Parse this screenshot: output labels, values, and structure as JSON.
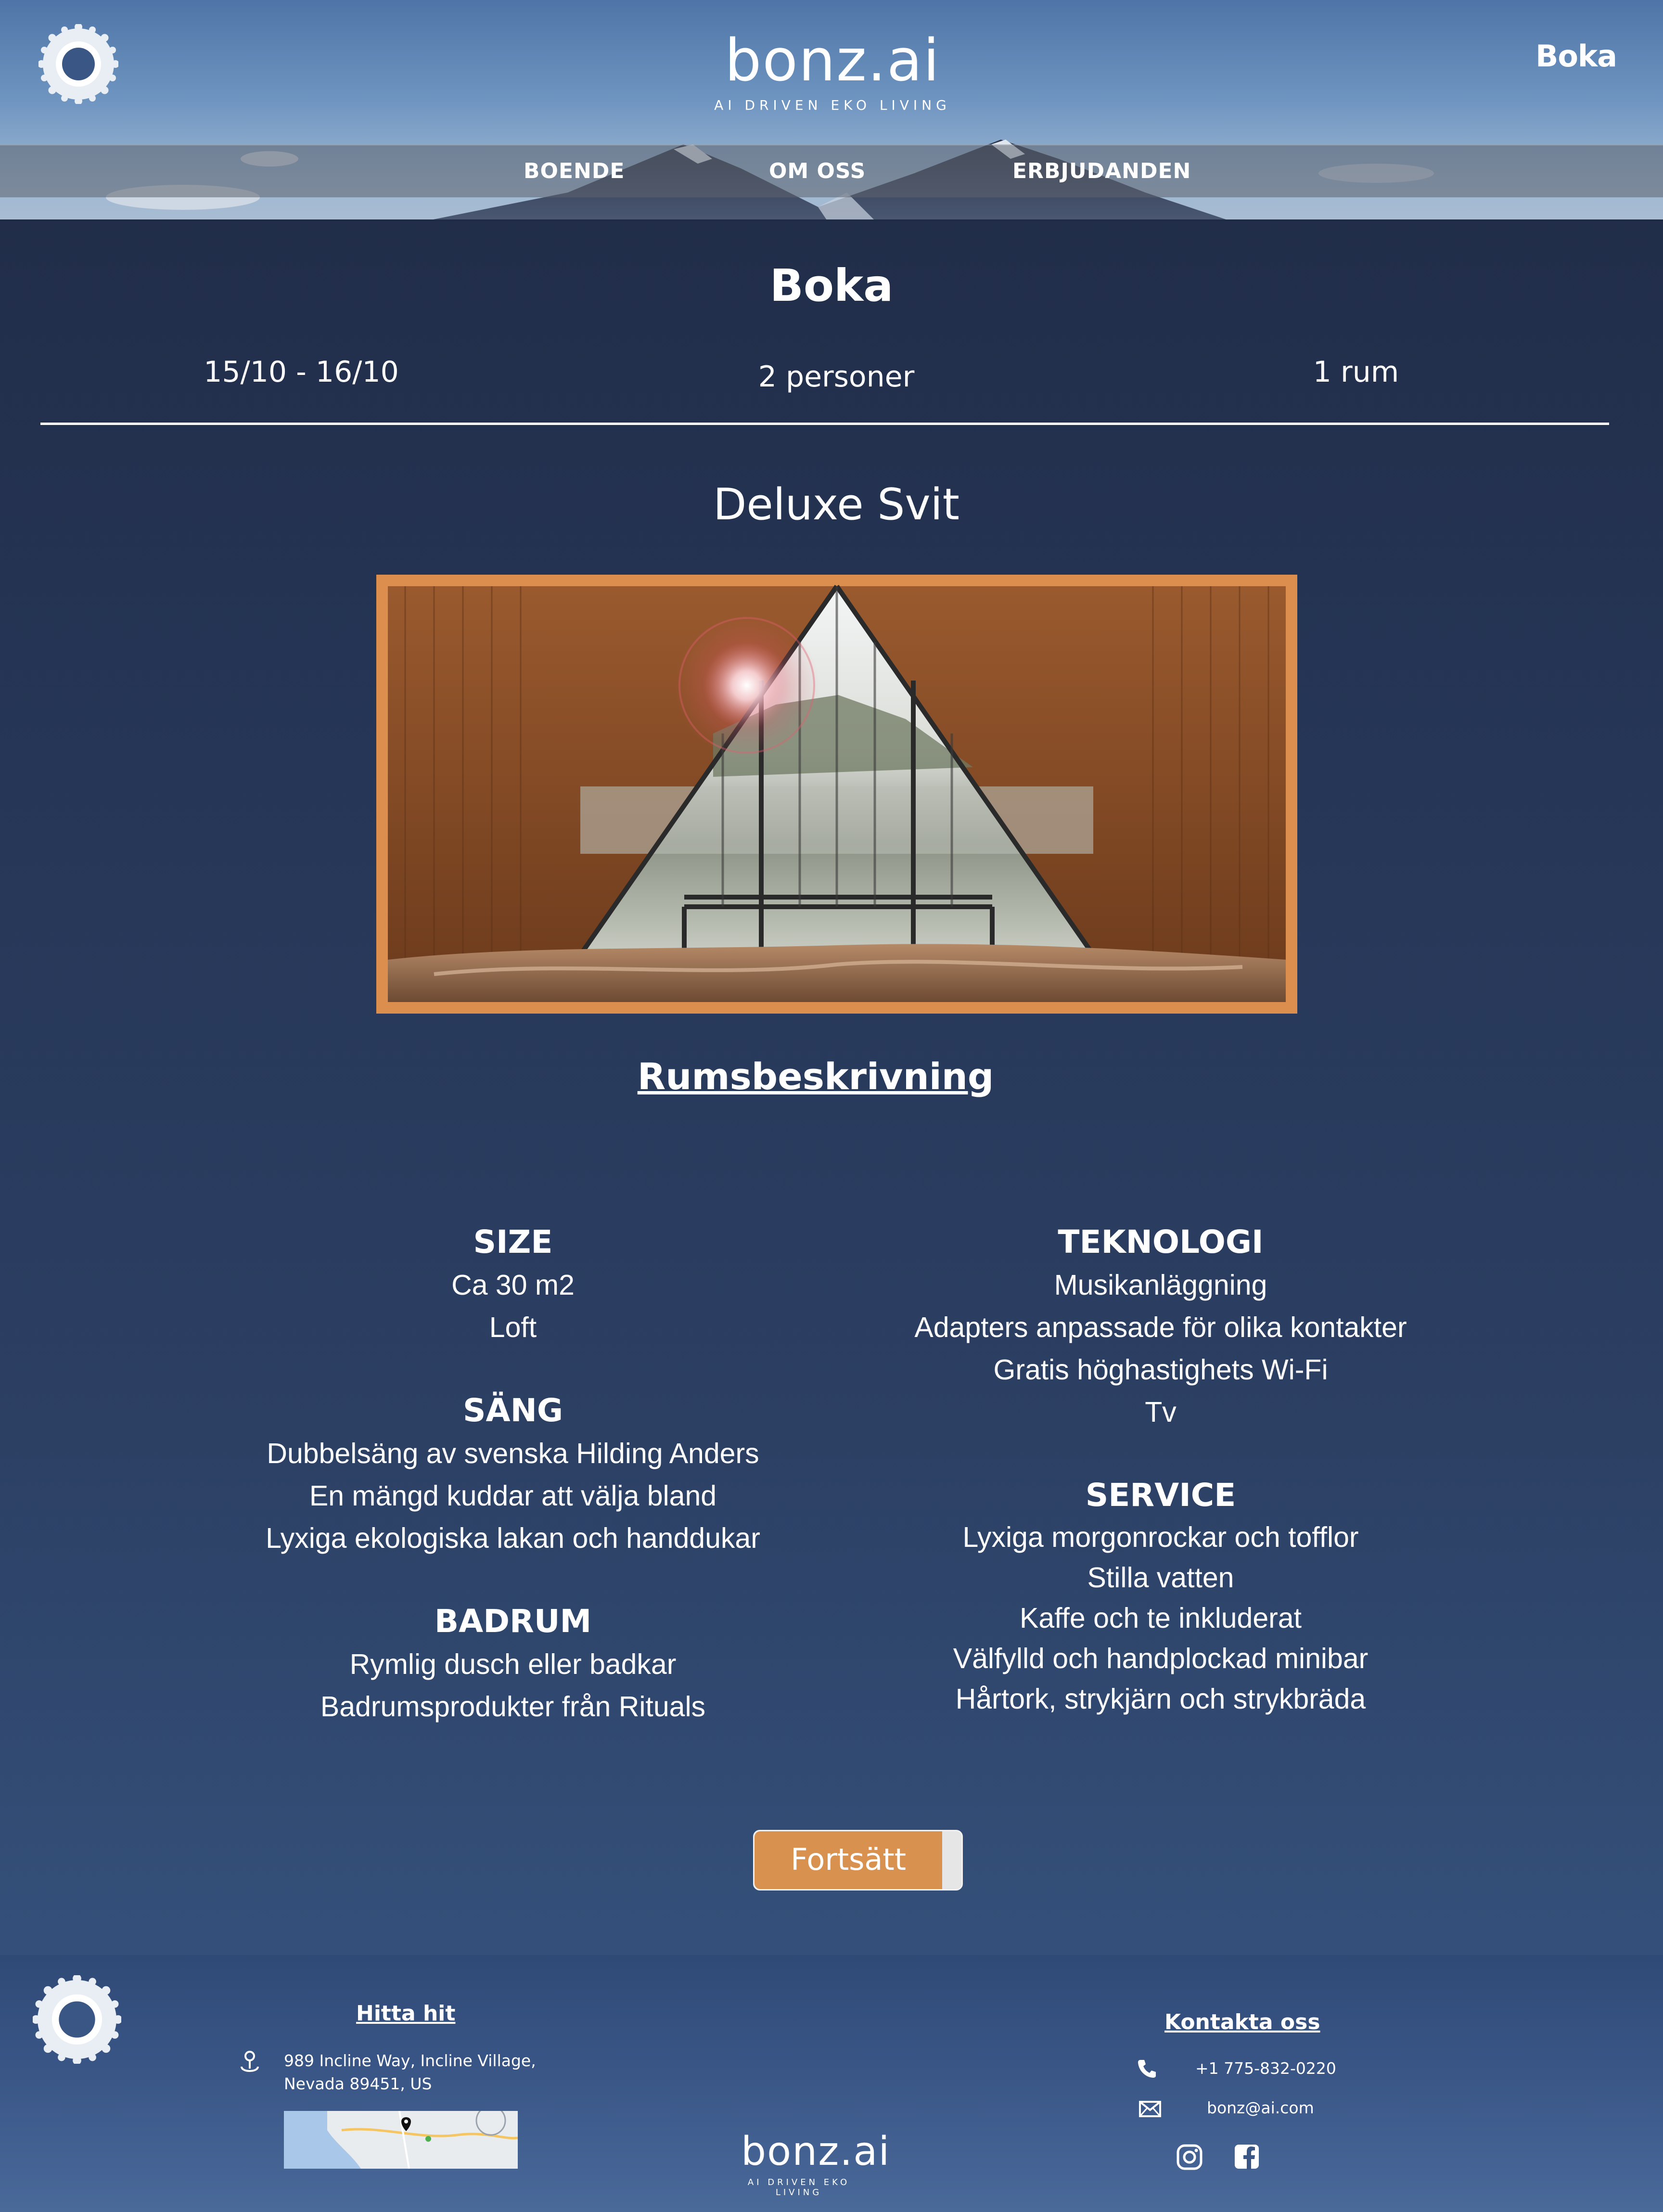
{
  "header": {
    "brand_name": "bonz.ai",
    "brand_tagline": "AI DRIVEN EKO LIVING",
    "cta_label": "Boka",
    "nav": [
      {
        "label": "BOENDE"
      },
      {
        "label": "OM OSS"
      },
      {
        "label": "ERBJUDANDEN"
      }
    ]
  },
  "booking": {
    "title": "Boka",
    "dates": "15/10 - 16/10",
    "guests": "2 personer",
    "rooms": "1 rum"
  },
  "room": {
    "name": "Deluxe Svit",
    "description_link": "Rumsbeskrivning"
  },
  "features": {
    "size": {
      "heading": "SIZE",
      "items": [
        "Ca 30 m2",
        "Loft"
      ]
    },
    "bed": {
      "heading": "SÄNG",
      "items": [
        "Dubbelsäng av svenska Hilding Anders",
        "En mängd kuddar att välja bland",
        "Lyxiga ekologiska lakan och handdukar"
      ]
    },
    "bathroom": {
      "heading": "BADRUM",
      "items": [
        "Rymlig dusch eller badkar",
        "Badrumsprodukter från Rituals"
      ]
    },
    "technology": {
      "heading": "TEKNOLOGI",
      "items": [
        "Musikanläggning",
        "Adapters anpassade för olika kontakter",
        "Gratis höghastighets Wi-Fi",
        "Tv"
      ]
    },
    "service": {
      "heading": "SERVICE",
      "items": [
        "Lyxiga morgonrockar och tofflor",
        "Stilla vatten",
        "Kaffe och te inkluderat",
        "Välfylld och handplockad minibar",
        "Hårtork, strykjärn och strykbräda"
      ]
    }
  },
  "continue_label": "Fortsätt",
  "footer": {
    "find_us": "Hitta hit",
    "address_line1": "989 Incline Way, Incline Village,",
    "address_line2": "Nevada 89451, US",
    "contact": "Kontakta oss",
    "phone": "+1 775-832-0220",
    "email": "bonz@ai.com",
    "brand_name": "bonz.ai",
    "brand_tagline": "AI DRIVEN EKO LIVING"
  },
  "colors": {
    "accent": "#d9914f",
    "background": "#243352"
  },
  "icons": [
    "sun-logo-icon",
    "location-pin-icon",
    "phone-icon",
    "mail-icon",
    "instagram-icon",
    "facebook-icon"
  ]
}
